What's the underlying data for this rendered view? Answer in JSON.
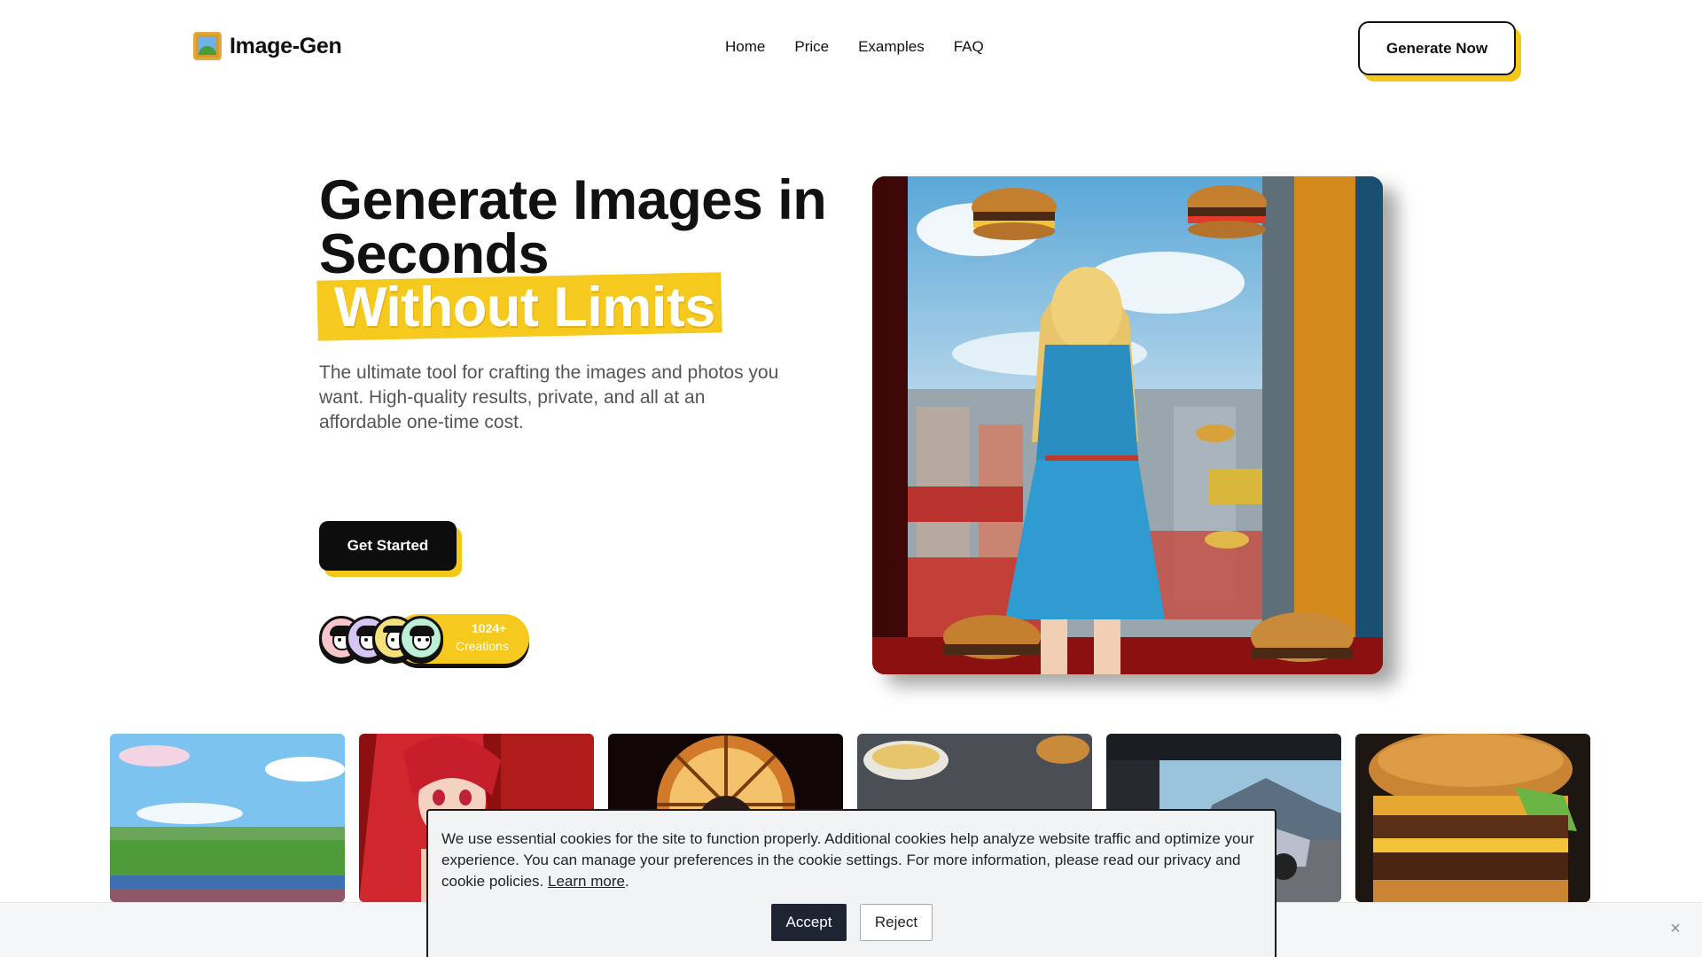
{
  "brand": {
    "name": "Image-Gen",
    "logo_icon": "framed-picture-icon"
  },
  "nav": {
    "items": [
      {
        "label": "Home"
      },
      {
        "label": "Price"
      },
      {
        "label": "Examples"
      },
      {
        "label": "FAQ"
      }
    ]
  },
  "header": {
    "cta_label": "Generate Now"
  },
  "hero": {
    "title_line1": "Generate Images in",
    "title_line2": "Seconds",
    "highlight": "Without Limits",
    "subtitle": "The ultimate tool for crafting the images and photos you want. High-quality results, private, and all at an affordable one-time cost.",
    "cta_label": "Get Started",
    "creations_count": "1024+",
    "creations_label": "Creations",
    "avatar_colors": [
      "#f7c6cb",
      "#d7c6f3",
      "#f5e27a",
      "#bdeed6"
    ]
  },
  "gallery": {
    "items": [
      {
        "name": "pixel-landscape"
      },
      {
        "name": "red-hair-anime-girl"
      },
      {
        "name": "window-portrait"
      },
      {
        "name": "burrito-plate"
      },
      {
        "name": "sports-car"
      },
      {
        "name": "cheeseburger"
      }
    ]
  },
  "cookie": {
    "text": "We use essential cookies for the site to function properly. Additional cookies help analyze website traffic and optimize your experience. You can manage your preferences in the cookie settings. For more information, please read our privacy and cookie policies.",
    "learn_more": "Learn more",
    "accept_label": "Accept",
    "reject_label": "Reject",
    "close_glyph": "×"
  },
  "colors": {
    "accent": "#f6c91e",
    "dark": "#0d0d0d",
    "cookie_button": "#1f2432"
  }
}
